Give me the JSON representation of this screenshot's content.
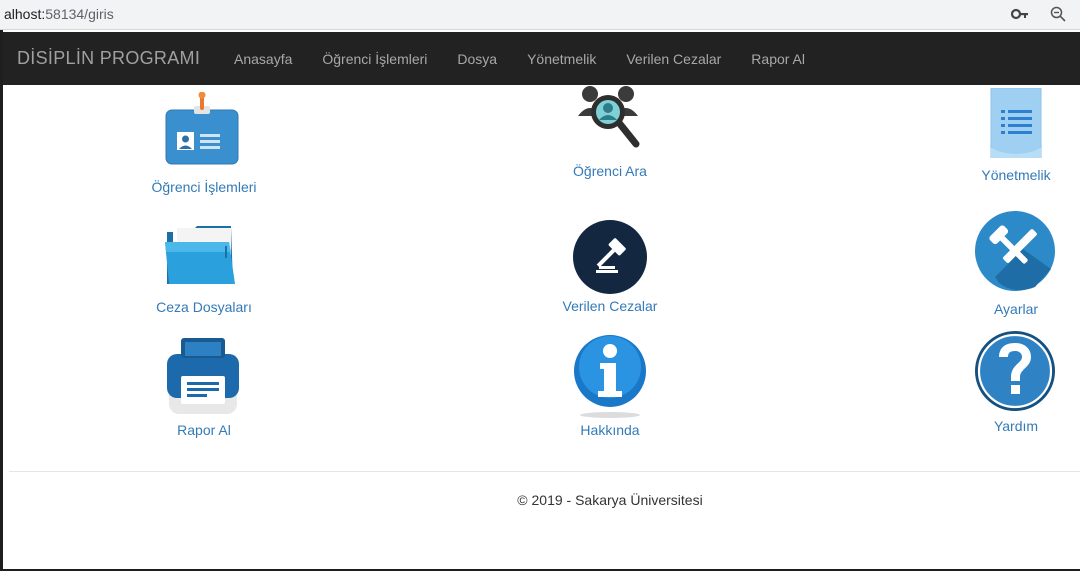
{
  "browser": {
    "url_host": "alhost:",
    "url_path": "58134/giris",
    "icons": [
      "key-icon",
      "zoom-icon"
    ]
  },
  "navbar": {
    "brand": "DİSİPLİN PROGRAMI",
    "links": [
      "Anasayfa",
      "Öğrenci İşlemleri",
      "Dosya",
      "Yönetmelik",
      "Verilen Cezalar",
      "Rapor Al"
    ]
  },
  "tiles": {
    "ogrenci_islemleri": "Öğrenci İşlemleri",
    "ogrenci_ara": "Öğrenci Ara",
    "yonetmelik": "Yönetmelik",
    "ceza_dosyalari": "Ceza Dosyaları",
    "verilen_cezalar": "Verilen Cezalar",
    "ayarlar": "Ayarlar",
    "rapor_al": "Rapor Al",
    "hakkinda": "Hakkında",
    "yardim": "Yardım"
  },
  "footer": {
    "text": "© 2019 - Sakarya Üniversitesi"
  },
  "colors": {
    "navbar_bg": "#222222",
    "link": "#337ab7",
    "accent_blue": "#2f9bd6"
  }
}
